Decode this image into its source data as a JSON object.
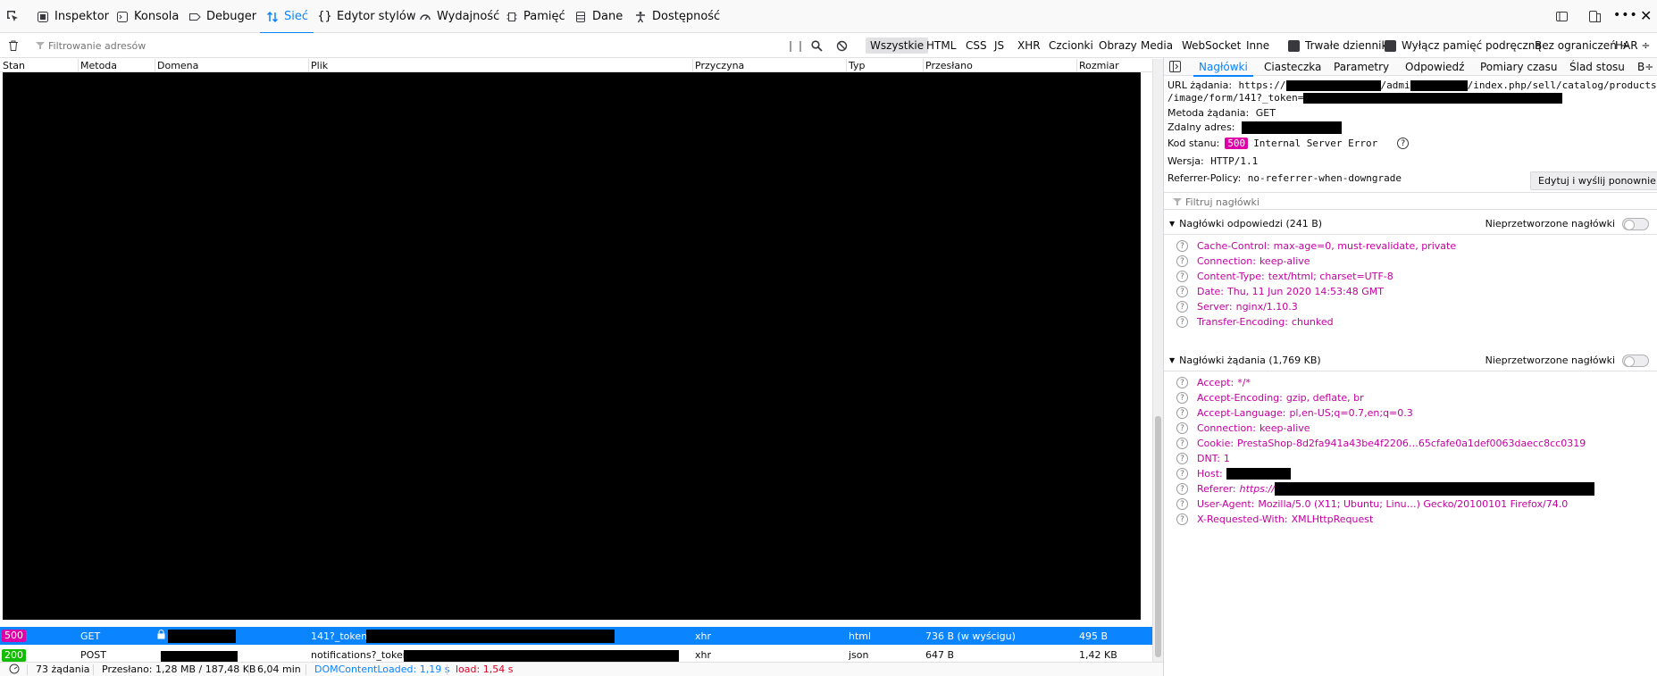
{
  "toolbar": {
    "tabs": [
      {
        "label": "Inspektor",
        "icon": "inspector-icon"
      },
      {
        "label": "Konsola",
        "icon": "console-icon"
      },
      {
        "label": "Debuger",
        "icon": "debugger-icon"
      },
      {
        "label": "Sieć",
        "icon": "network-icon"
      },
      {
        "label": "Edytor stylów",
        "icon": "style-editor-icon"
      },
      {
        "label": "Wydajność",
        "icon": "performance-icon"
      },
      {
        "label": "Pamięć",
        "icon": "memory-icon"
      },
      {
        "label": "Dane",
        "icon": "storage-icon"
      },
      {
        "label": "Dostępność",
        "icon": "accessibility-icon"
      }
    ],
    "active_tab": "Sieć",
    "accent_color": "#0a84ff"
  },
  "filterbar": {
    "placeholder": "Filtrowanie adresów",
    "pause_icon": "pause-icon",
    "types": [
      "Wszystkie",
      "HTML",
      "CSS",
      "JS",
      "XHR",
      "Czcionki",
      "Obrazy",
      "Media",
      "WebSocket",
      "Inne"
    ],
    "active_type": "Wszystkie",
    "persist_logs": "Trwałe dzienniki",
    "disable_cache": "Wyłącz pamięć podręczną",
    "throttle": "Bez ograniczeń ÷",
    "har": "HAR ÷"
  },
  "table": {
    "columns": [
      "Stan",
      "Metoda",
      "Domena",
      "Plik",
      "Przyczyna",
      "Typ",
      "Przesłano",
      "Rozmiar"
    ],
    "rows": [
      {
        "status": "500",
        "status_color": "#dd00a9",
        "method": "GET",
        "file": "141?_token=",
        "cause": "xhr",
        "type": "html",
        "transferred": "736 B (w wyścigu)",
        "size": "495 B",
        "selected": true
      },
      {
        "status": "200",
        "status_color": "#12bc00",
        "method": "POST",
        "file": "notifications?_token=",
        "cause": "xhr",
        "type": "json",
        "transferred": "647 B",
        "size": "1,42 KB",
        "selected": false
      }
    ]
  },
  "statusbar": {
    "requests": "73 żądania",
    "transferred": "Przesłano: 1,28 MB / 187,48 KB",
    "finish": "6,04 min",
    "dom_loaded": "DOMContentLoaded: 1,19 s",
    "load": "load: 1,54 s"
  },
  "panel": {
    "tabs": [
      "Nagłówki",
      "Ciasteczka",
      "Parametry",
      "Odpowiedź",
      "Pomiary czasu",
      "Ślad stosu",
      "B÷"
    ],
    "active_tab": "Nagłówki",
    "url_label": "URL żądania:",
    "url_value_1": "https://",
    "url_value_2": "/admi",
    "url_value_3": "/index.php/sell/catalog/products",
    "url_value_4": "/image/form/141?_token=",
    "method_label": "Metoda żądania:",
    "method_value": "GET",
    "remote_label": "Zdalny adres:",
    "status_label": "Kod stanu:",
    "status_code": "500",
    "status_text": "Internal Server Error",
    "version_label": "Wersja:",
    "version_value": "HTTP/1.1",
    "referrer_policy_label": "Referrer-Policy:",
    "referrer_policy_value": "no-referrer-when-downgrade",
    "resend_button": "Edytuj i wyślij ponownie",
    "filter_placeholder": "Filtruj nagłówki",
    "response_section": "Nagłówki odpowiedzi (241 B)",
    "raw_toggle": "Nieprzetworzone nagłówki",
    "response_headers": [
      {
        "name": "Cache-Control:",
        "value": "max-age=0, must-revalidate, private"
      },
      {
        "name": "Connection:",
        "value": "keep-alive"
      },
      {
        "name": "Content-Type:",
        "value": "text/html; charset=UTF-8"
      },
      {
        "name": "Date:",
        "value": "Thu, 11 Jun 2020 14:53:48 GMT"
      },
      {
        "name": "Server:",
        "value": "nginx/1.10.3"
      },
      {
        "name": "Transfer-Encoding:",
        "value": "chunked"
      }
    ],
    "request_section": "Nagłówki żądania (1,769 KB)",
    "request_headers": [
      {
        "name": "Accept:",
        "value": "*/*"
      },
      {
        "name": "Accept-Encoding:",
        "value": "gzip, deflate, br"
      },
      {
        "name": "Accept-Language:",
        "value": "pl,en-US;q=0.7,en;q=0.3"
      },
      {
        "name": "Connection:",
        "value": "keep-alive"
      },
      {
        "name": "Cookie:",
        "value": "PrestaShop-8d2fa941a43be4f2206…65cfafe0a1def0063daecc8cc0319"
      },
      {
        "name": "DNT:",
        "value": "1"
      },
      {
        "name": "Host:",
        "value": ""
      },
      {
        "name": "Referer:",
        "value": "https://"
      },
      {
        "name": "User-Agent:",
        "value": "Mozilla/5.0 (X11; Ubuntu; Linu…) Gecko/20100101 Firefox/74.0"
      },
      {
        "name": "X-Requested-With:",
        "value": "XMLHttpRequest"
      }
    ],
    "header_color": "#c200a0"
  }
}
